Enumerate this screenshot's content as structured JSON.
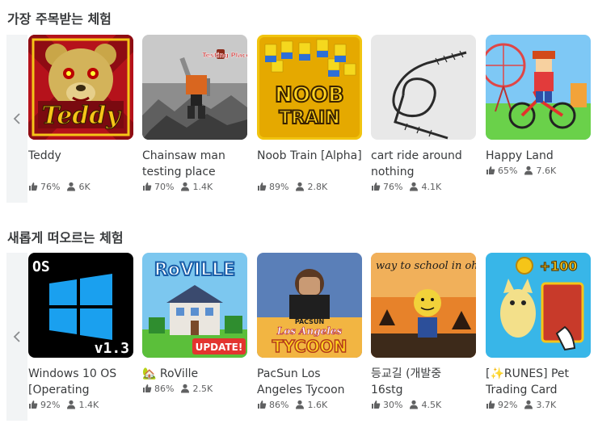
{
  "sections": [
    {
      "title": "가장 주목받는 체험",
      "games": [
        {
          "name": "Teddy",
          "rating": "76%",
          "players": "6K"
        },
        {
          "name": "Chainsaw man testing place",
          "rating": "70%",
          "players": "1.4K",
          "thumb_text": "Testing Place"
        },
        {
          "name": "Noob Train [Alpha]",
          "rating": "89%",
          "players": "2.8K",
          "thumb_text_1": "NOOB",
          "thumb_text_2": "TRAIN"
        },
        {
          "name": "cart ride around nothing",
          "rating": "76%",
          "players": "4.1K"
        },
        {
          "name": "Happy Land",
          "rating": "65%",
          "players": "7.6K"
        }
      ]
    },
    {
      "title": "새롭게 떠오르는 체험",
      "games": [
        {
          "name": "Windows 10 OS [Operating",
          "rating": "92%",
          "players": "1.4K",
          "thumb_text_1": "OS",
          "thumb_text_2": "v1.3"
        },
        {
          "name": "🏡 RoVille",
          "rating": "86%",
          "players": "2.5K",
          "thumb_text_1": "RoVILLE",
          "thumb_text_2": "UPDATE!"
        },
        {
          "name": "PacSun Los Angeles Tycoon",
          "rating": "86%",
          "players": "1.6K",
          "thumb_text_1": "PACSUN",
          "thumb_text_2": "Los Angeles",
          "thumb_text_3": "TYCOON"
        },
        {
          "name": "등교길 (개발중 16stg",
          "rating": "30%",
          "players": "4.5K",
          "thumb_text": "way to school in ohio"
        },
        {
          "name": "[✨RUNES] Pet Trading Card",
          "rating": "92%",
          "players": "3.7K",
          "thumb_text": "+100"
        }
      ]
    }
  ],
  "colors": {
    "rating_icon": "#606162",
    "scroll_bg": "#f2f4f5",
    "text": "#393b3d"
  }
}
